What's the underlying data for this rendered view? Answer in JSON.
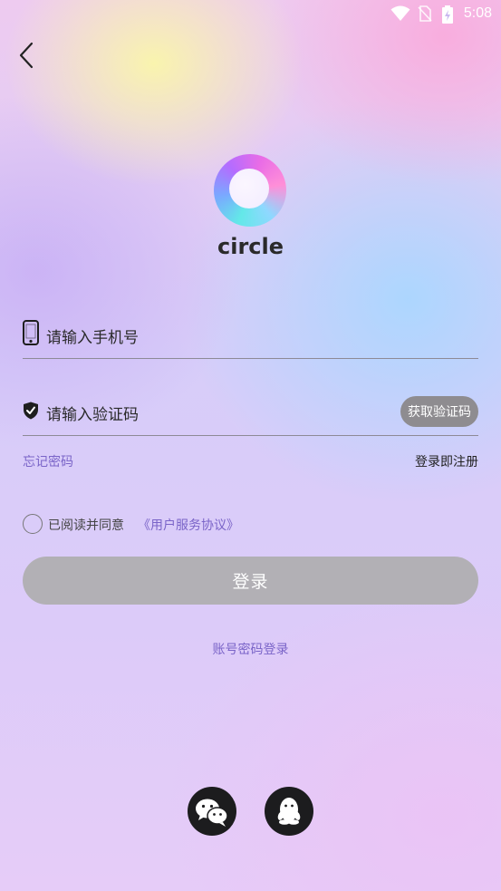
{
  "status_bar": {
    "time": "5:08",
    "icons": [
      "wifi-icon",
      "no-sim-icon",
      "battery-charging-icon"
    ]
  },
  "header": {
    "back_icon": "back-chevron-icon"
  },
  "brand": {
    "logo_icon": "circle-logo-icon",
    "name": "circle"
  },
  "form": {
    "phone": {
      "icon": "phone-icon",
      "placeholder": "请输入手机号",
      "value": ""
    },
    "code": {
      "icon": "shield-check-icon",
      "placeholder": "请输入验证码",
      "value": "",
      "get_code_label": "获取验证码"
    },
    "forgot_password": "忘记密码",
    "register": "登录即注册"
  },
  "agreement": {
    "checked": false,
    "text": "已阅读并同意",
    "link": "《用户服务协议》"
  },
  "login_button": "登录",
  "password_login": "账号密码登录",
  "social": [
    {
      "icon": "wechat-icon"
    },
    {
      "icon": "qq-icon"
    }
  ],
  "colors": {
    "accent": "#7a64c8",
    "button_disabled": "#b2b0b5",
    "code_button": "#8e8c90",
    "social_bg": "#1c1c1e"
  }
}
